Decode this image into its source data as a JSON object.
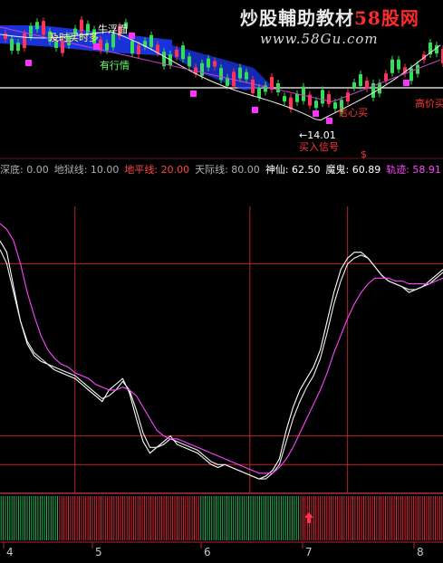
{
  "watermark": {
    "brand": "炒股輔助教材",
    "brand_red": "58股网",
    "url": "www.58Gu.com"
  },
  "price_panel": {
    "labels": [
      {
        "text": "及时买时多",
        "color": "#ffff66"
      },
      {
        "text": "牛浮面",
        "color": "#ffffff"
      },
      {
        "text": "有行情",
        "color": "#66ff66"
      },
      {
        "text": "买入信号",
        "color": "#ff3333"
      },
      {
        "text": "信心买",
        "color": "#ff3333"
      },
      {
        "text": "高价买",
        "color": "#ff3333"
      },
      {
        "text": "←14.01",
        "color": "#ffffff"
      },
      {
        "text": "$",
        "color": "#ff3333"
      }
    ]
  },
  "legend": [
    {
      "label": "深底:",
      "value": "0.00",
      "color": "#b0b0b0"
    },
    {
      "label": "地狱线:",
      "value": "10.00",
      "color": "#b0b0b0"
    },
    {
      "label": "地平线:",
      "value": "20.00",
      "color": "#ff4444"
    },
    {
      "label": "天际线:",
      "value": "80.00",
      "color": "#b0b0b0"
    },
    {
      "label": "神仙:",
      "value": "62.50",
      "color": "#ffffff"
    },
    {
      "label": "魔鬼:",
      "value": "60.89",
      "color": "#ffffff"
    },
    {
      "label": "轨迹:",
      "value": "58.91",
      "color": "#ff44ff"
    }
  ],
  "x_axis": {
    "labels": [
      "4",
      "5",
      "6",
      "7",
      "8"
    ]
  },
  "chart_data": {
    "type": "line",
    "ylim": [
      0,
      100
    ],
    "reference_lines": [
      {
        "name": "天际线",
        "y": 80
      },
      {
        "name": "地平线",
        "y": 20
      },
      {
        "name": "地狱线",
        "y": 10
      },
      {
        "name": "深底",
        "y": 0
      }
    ],
    "x": [
      0,
      3,
      6,
      9,
      12,
      15,
      18,
      21,
      24,
      27,
      30,
      33,
      36,
      39,
      42,
      45,
      48,
      51,
      54,
      57,
      60,
      63,
      66,
      69,
      72,
      75,
      78,
      81,
      84,
      87,
      90,
      93,
      96,
      99,
      102,
      105,
      108,
      111,
      114,
      117,
      120,
      123,
      126,
      129,
      132,
      135,
      138,
      141,
      144,
      147,
      150,
      153,
      156,
      159,
      162,
      165,
      168,
      171,
      174,
      177,
      180,
      183,
      186,
      189,
      192,
      195
    ],
    "series": [
      {
        "name": "神仙",
        "color": "#ffffff",
        "values": [
          88,
          84,
          72,
          60,
          52,
          48,
          46,
          45,
          43,
          42,
          41,
          40,
          38,
          36,
          34,
          32,
          36,
          38,
          40,
          35,
          26,
          18,
          14,
          16,
          18,
          20,
          17,
          16,
          15,
          14,
          12,
          10,
          9,
          10,
          9,
          8,
          7,
          6,
          5,
          6,
          8,
          12,
          22,
          30,
          36,
          40,
          44,
          50,
          60,
          70,
          78,
          82,
          84,
          84,
          82,
          79,
          76,
          74,
          73,
          72,
          70,
          71,
          72,
          74,
          76,
          78
        ]
      },
      {
        "name": "魔鬼",
        "color": "#f0f0f0",
        "values": [
          85,
          80,
          70,
          60,
          53,
          49,
          47,
          45,
          44,
          43,
          42,
          41,
          39,
          37,
          35,
          33,
          34,
          36,
          39,
          36,
          29,
          21,
          16,
          16,
          17,
          19,
          18,
          17,
          16,
          15,
          13,
          11,
          10,
          10,
          9,
          8,
          7,
          6,
          5,
          5,
          7,
          10,
          18,
          26,
          32,
          37,
          41,
          47,
          56,
          66,
          74,
          80,
          82,
          83,
          82,
          79,
          76,
          74,
          73,
          72,
          71,
          71,
          72,
          73,
          75,
          77
        ]
      },
      {
        "name": "轨迹",
        "color": "#ff44ff",
        "values": [
          94,
          92,
          88,
          80,
          70,
          62,
          55,
          50,
          47,
          45,
          44,
          42,
          41,
          40,
          38,
          37,
          36,
          36,
          37,
          36,
          34,
          30,
          26,
          22,
          20,
          19,
          19,
          18,
          17,
          16,
          15,
          14,
          13,
          12,
          11,
          10,
          9,
          8,
          7,
          7,
          7,
          9,
          12,
          16,
          21,
          26,
          31,
          36,
          42,
          49,
          55,
          61,
          66,
          70,
          73,
          75,
          75,
          75,
          74,
          74,
          73,
          73,
          73,
          73,
          74,
          75
        ]
      }
    ],
    "signal_bars": {
      "type": "bar",
      "up_color": "#ff3344",
      "down_color": "#33cc66",
      "bars": [
        "down",
        "down",
        "down",
        "down",
        "down",
        "down",
        "down",
        "down",
        "down",
        "down",
        "down",
        "down",
        "down",
        "down",
        "down",
        "down",
        "down",
        "down",
        "down",
        "down",
        "down",
        "down",
        "down",
        "down",
        "down",
        "down",
        "down",
        "up",
        "up",
        "up",
        "up",
        "up",
        "up",
        "up",
        "up",
        "up",
        "up",
        "up",
        "up",
        "up",
        "up",
        "up",
        "up",
        "up",
        "up",
        "up",
        "up",
        "up",
        "up",
        "up",
        "up",
        "up",
        "up",
        "up",
        "up",
        "up",
        "up",
        "up",
        "up",
        "up",
        "up",
        "up",
        "up",
        "up",
        "up",
        "up",
        "up",
        "up",
        "up",
        "up",
        "up",
        "up",
        "up",
        "up",
        "up",
        "up",
        "up",
        "up",
        "up",
        "up",
        "up",
        "up",
        "up",
        "up",
        "up",
        "up",
        "up",
        "up",
        "up",
        "up",
        "up",
        "up",
        "down",
        "down",
        "down",
        "down",
        "down",
        "down",
        "down",
        "down",
        "down",
        "down",
        "down",
        "down",
        "down",
        "down",
        "down",
        "down",
        "down",
        "down",
        "down",
        "down",
        "down",
        "down",
        "down",
        "down",
        "down",
        "down",
        "down",
        "down",
        "down",
        "down",
        "down",
        "down",
        "down",
        "down",
        "down",
        "down",
        "down",
        "down",
        "down",
        "down",
        "down",
        "down",
        "down",
        "down",
        "down",
        "down",
        "up",
        "up",
        "up",
        "up",
        "up",
        "up",
        "up",
        "up",
        "up",
        "up",
        "up",
        "up",
        "up",
        "up",
        "up",
        "up",
        "up",
        "up",
        "up",
        "up",
        "up",
        "up",
        "up",
        "up",
        "up",
        "up",
        "up",
        "up",
        "up",
        "up",
        "up",
        "up",
        "up",
        "up",
        "up",
        "up",
        "up",
        "up",
        "up",
        "up",
        "up",
        "up",
        "up",
        "up",
        "up",
        "up",
        "up",
        "up",
        "up",
        "up",
        "up",
        "up",
        "up",
        "up",
        "up",
        "up",
        "up",
        "up",
        "up",
        "up",
        "up",
        "up",
        "up",
        "up",
        "up",
        "up"
      ]
    },
    "vertical_markers": [
      33,
      110,
      153
    ]
  }
}
